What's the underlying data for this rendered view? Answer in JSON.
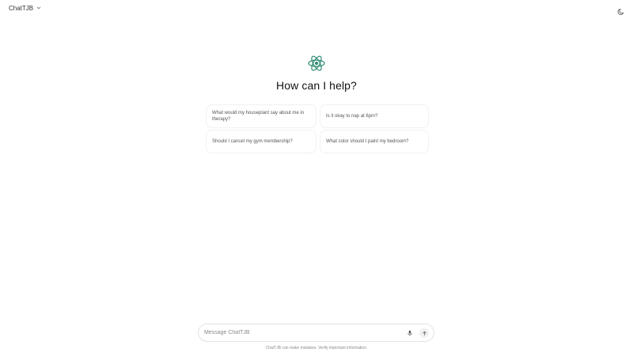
{
  "header": {
    "model_name": "ChatTJB",
    "model_chevron_icon": "chevron-down-icon",
    "theme_toggle_icon": "moon-icon"
  },
  "hero": {
    "logo_icon": "atom-icon",
    "heading": "How can I help?"
  },
  "suggestions": [
    {
      "label": "What would my houseplant say about me in therapy?"
    },
    {
      "label": "Is it okay to nap at 6pm?"
    },
    {
      "label": "Should I cancel my gym membership?"
    },
    {
      "label": "What color should I paint my bedroom?"
    }
  ],
  "composer": {
    "placeholder": "Message ChatTJB",
    "value": "",
    "mic_icon": "microphone-icon",
    "send_icon": "arrow-up-icon"
  },
  "footer": {
    "disclaimer": "ChatTJB can make mistakes. Verify important information."
  },
  "colors": {
    "accent": "#2e8b72",
    "background": "#ffffff"
  }
}
